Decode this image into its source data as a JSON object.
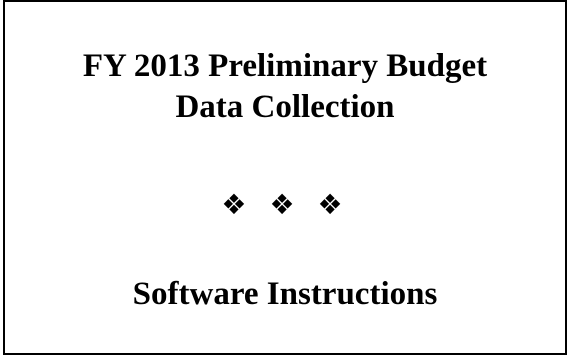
{
  "document": {
    "title_line_1": "FY 2013 Preliminary Budget",
    "title_line_2": "Data Collection",
    "ornament": [
      "❖",
      "❖",
      "❖"
    ],
    "subtitle": "Software Instructions"
  },
  "colors": {
    "text": "#000000",
    "background": "#ffffff",
    "border": "#000000"
  }
}
